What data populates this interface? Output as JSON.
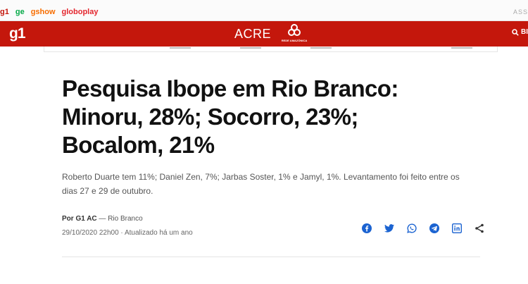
{
  "portals": [
    {
      "label": "g1"
    },
    {
      "label": "ge"
    },
    {
      "label": "gshow"
    },
    {
      "label": "globoplay"
    }
  ],
  "portal_right": "ASS",
  "header": {
    "logo": "g1",
    "region": "ACRE",
    "affiliate_name": "REDE AMAZÔNICA",
    "search_label": "BI",
    "brand_color": "#c4170c"
  },
  "article": {
    "title": "Pesquisa Ibope em Rio Branco: Minoru, 28%; Socorro, 23%; Bocalom, 21%",
    "subtitle": "Roberto Duarte tem 11%; Daniel Zen, 7%; Jarbas Soster, 1% e Jamyl, 1%. Levantamento foi feito entre os dias 27 e 29 de outubro.",
    "author_prefix": "Por G1 AC",
    "author_suffix": " — Rio Branco",
    "dateline": "29/10/2020 22h00 · Atualizado há um ano"
  },
  "share": [
    {
      "icon": "facebook-icon",
      "color": "#1b63d1"
    },
    {
      "icon": "twitter-icon",
      "color": "#1b63d1"
    },
    {
      "icon": "whatsapp-icon",
      "color": "#1b63d1"
    },
    {
      "icon": "telegram-icon",
      "color": "#1b63d1"
    },
    {
      "icon": "linkedin-icon",
      "color": "#1b63d1"
    },
    {
      "icon": "share-icon",
      "color": "#333333"
    }
  ]
}
